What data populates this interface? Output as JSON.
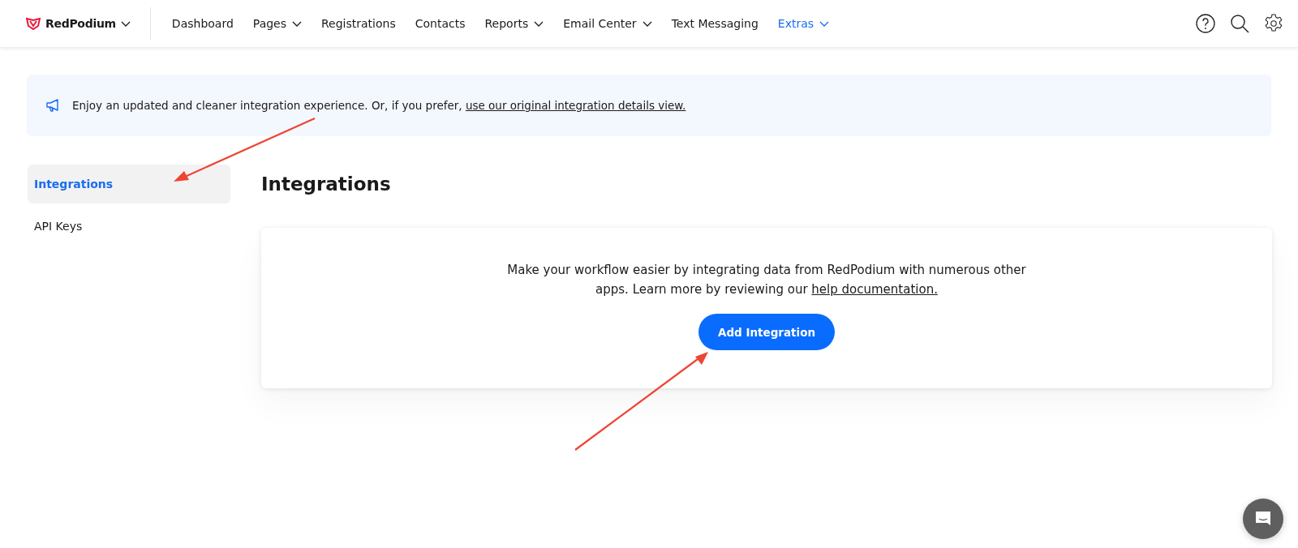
{
  "brand": {
    "name": "RedPodium"
  },
  "nav": [
    {
      "label": "Dashboard",
      "dropdown": false,
      "selected": false
    },
    {
      "label": "Pages",
      "dropdown": true,
      "selected": false
    },
    {
      "label": "Registrations",
      "dropdown": false,
      "selected": false
    },
    {
      "label": "Contacts",
      "dropdown": false,
      "selected": false
    },
    {
      "label": "Reports",
      "dropdown": true,
      "selected": false
    },
    {
      "label": "Email Center",
      "dropdown": true,
      "selected": false
    },
    {
      "label": "Text Messaging",
      "dropdown": false,
      "selected": false
    },
    {
      "label": "Extras",
      "dropdown": true,
      "selected": true
    }
  ],
  "banner": {
    "text": "Enjoy an updated and cleaner integration experience. Or, if you prefer,",
    "link": "use our original integration details view."
  },
  "sidebar": {
    "items": [
      {
        "label": "Integrations",
        "selected": true
      },
      {
        "label": "API Keys",
        "selected": false
      }
    ]
  },
  "main": {
    "title": "Integrations",
    "card": {
      "text": "Make your workflow easier by integrating data from RedPodium with numerous other apps. Learn more by reviewing our",
      "link": "help documentation.",
      "button": "Add Integration"
    }
  }
}
